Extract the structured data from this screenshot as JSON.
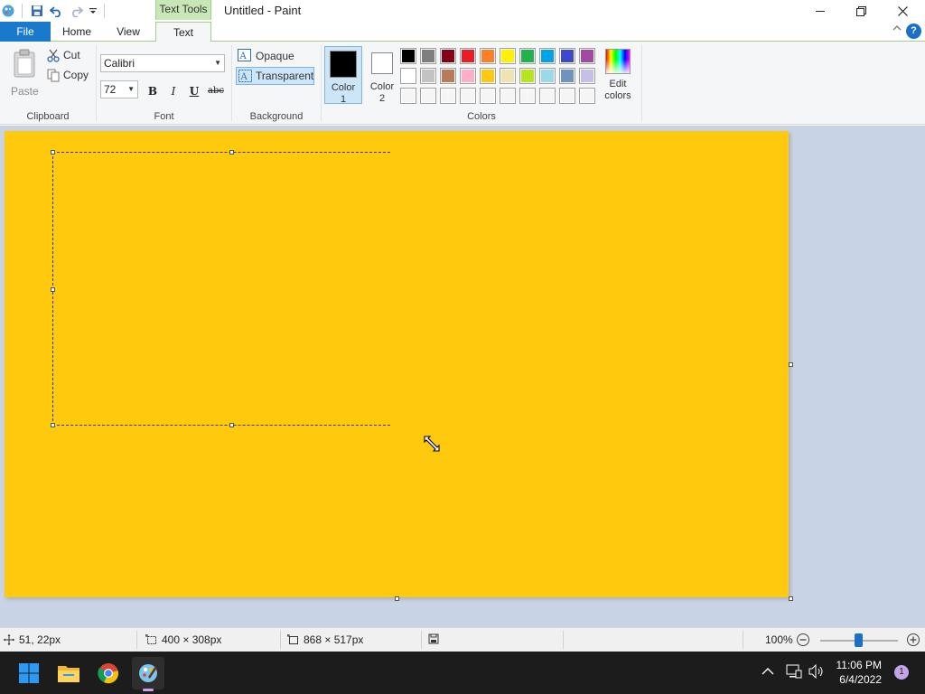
{
  "window": {
    "title": "Untitled - Paint",
    "context_tab_group": "Text Tools"
  },
  "tabs": {
    "file": "File",
    "home": "Home",
    "view": "View",
    "text": "Text"
  },
  "clipboard": {
    "paste": "Paste",
    "cut": "Cut",
    "copy": "Copy",
    "label": "Clipboard"
  },
  "font": {
    "family": "Calibri",
    "size": "72",
    "bold": "B",
    "italic": "I",
    "underline": "U",
    "strikethrough": "abc",
    "label": "Font"
  },
  "background": {
    "opaque": "Opaque",
    "transparent": "Transparent",
    "selected": "Transparent",
    "label": "Background"
  },
  "colors": {
    "color1_label_line1": "Color",
    "color1_label_line2": "1",
    "color2_label_line1": "Color",
    "color2_label_line2": "2",
    "color1_value": "#000000",
    "color2_value": "#ffffff",
    "edit_line1": "Edit",
    "edit_line2": "colors",
    "label": "Colors",
    "palette_row1": [
      "#000000",
      "#7f7f7f",
      "#880015",
      "#ed1c24",
      "#ff7f27",
      "#fff200",
      "#22b14c",
      "#00a2e8",
      "#3f48cc",
      "#a349a4"
    ],
    "palette_row2": [
      "#ffffff",
      "#c3c3c3",
      "#b97a57",
      "#ffaec9",
      "#ffc90e",
      "#efe4b0",
      "#b5e61d",
      "#99d9ea",
      "#7092be",
      "#c8bfe7"
    ],
    "palette_row3": [
      "#f5f5f5",
      "#f5f5f5",
      "#f5f5f5",
      "#f5f5f5",
      "#f5f5f5",
      "#f5f5f5",
      "#f5f5f5",
      "#f5f5f5",
      "#f5f5f5",
      "#f5f5f5"
    ]
  },
  "canvas": {
    "fill_color": "#ffc90e",
    "workspace_color": "#c9d3e6"
  },
  "status": {
    "cursor_pos": "51, 22px",
    "selection_size": "400 × 308px",
    "image_size": "868 × 517px",
    "zoom": "100%"
  },
  "taskbar": {
    "time": "11:06 PM",
    "date": "6/4/2022",
    "notifications": "1"
  }
}
